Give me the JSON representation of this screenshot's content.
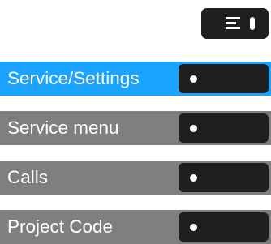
{
  "top_key": {
    "icon": "menu-lines-icon"
  },
  "menu": {
    "items": [
      {
        "label": "Service/Settings",
        "selected": true
      },
      {
        "label": "Service menu",
        "selected": false
      },
      {
        "label": "Calls",
        "selected": false
      },
      {
        "label": "Project Code",
        "selected": false
      }
    ]
  },
  "colors": {
    "selected_row": "#1aa3ff",
    "row": "#7f7f7f",
    "key": "#1f1f1f",
    "text": "#ffffff"
  }
}
